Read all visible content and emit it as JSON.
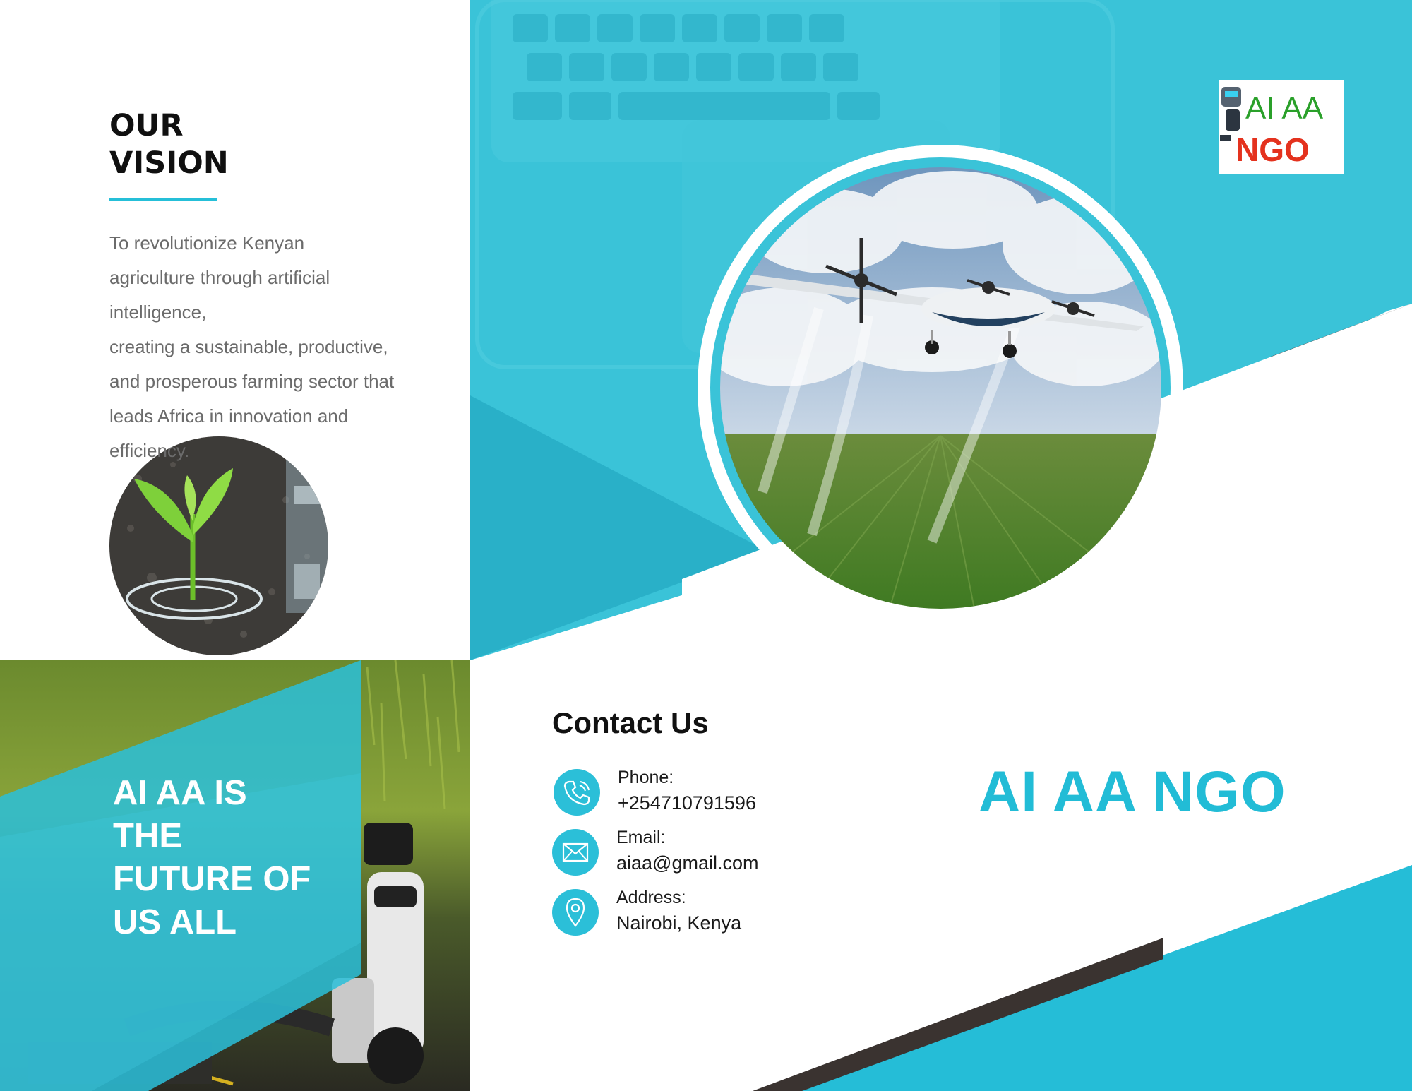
{
  "vision": {
    "title": "OUR\nVISION",
    "lines": [
      "To revolutionize Kenyan",
      "agriculture through artificial",
      "intelligence,",
      "creating a sustainable, productive,",
      "and prosperous farming sector that",
      "leads Africa in innovation and",
      "efficiency."
    ]
  },
  "tagline": {
    "lines": [
      "AI AA IS",
      "THE",
      "FUTURE OF",
      "US ALL"
    ]
  },
  "logo": {
    "line1": "AI AA",
    "line2": "NGO"
  },
  "contact": {
    "title": "Contact Us",
    "phone": {
      "label": "Phone:",
      "value": "+254710791596"
    },
    "email": {
      "label": "Email:",
      "value": "aiaa@gmail.com"
    },
    "address": {
      "label": "Address:",
      "value": "Nairobi, Kenya"
    }
  },
  "brand": {
    "name": "AI AA NGO"
  },
  "colors": {
    "accent": "#25bfd8",
    "accent_dark": "#1fa9c4",
    "dark_stripe": "#3a3330",
    "text": "#111111",
    "muted_text": "#6b6b6b"
  }
}
